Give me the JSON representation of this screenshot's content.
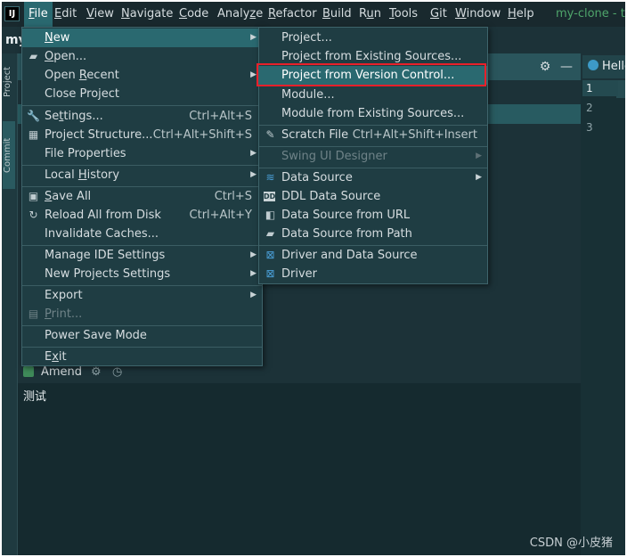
{
  "menubar": {
    "items": [
      {
        "pre": "",
        "u": "F",
        "post": "ile"
      },
      {
        "pre": "",
        "u": "E",
        "post": "dit"
      },
      {
        "pre": "",
        "u": "V",
        "post": "iew"
      },
      {
        "pre": "",
        "u": "N",
        "post": "avigate"
      },
      {
        "pre": "",
        "u": "C",
        "post": "ode"
      },
      {
        "pre": "Analy",
        "u": "z",
        "post": "e"
      },
      {
        "pre": "",
        "u": "R",
        "post": "efactor"
      },
      {
        "pre": "",
        "u": "B",
        "post": "uild"
      },
      {
        "pre": "R",
        "u": "u",
        "post": "n"
      },
      {
        "pre": "",
        "u": "T",
        "post": "ools"
      },
      {
        "pre": "",
        "u": "G",
        "post": "it"
      },
      {
        "pre": "",
        "u": "W",
        "post": "indow"
      },
      {
        "pre": "",
        "u": "H",
        "post": "elp"
      }
    ],
    "window_title": "my-clone - tes",
    "logo_text": "IJ"
  },
  "ide": {
    "project_head": "my",
    "project_tab": "Project",
    "commit_tab": "Commit",
    "editor_tab": "Hello",
    "line_numbers": [
      "1",
      "2",
      "3"
    ],
    "amend_label": "Amend",
    "commit_message": "测试",
    "watermark": "CSDN @小皮猪"
  },
  "file_menu": {
    "items": [
      {
        "pre": "",
        "u": "N",
        "post": "ew",
        "shortcut": "",
        "submenu": true,
        "icon": "",
        "selected": true
      },
      {
        "pre": "",
        "u": "O",
        "post": "pen...",
        "shortcut": "",
        "icon": "folder-icon"
      },
      {
        "pre": "Open ",
        "u": "R",
        "post": "ecent",
        "shortcut": "",
        "submenu": true
      },
      {
        "pre": "Close Project",
        "u": "",
        "post": "",
        "shortcut": ""
      },
      {
        "pre": "Se",
        "u": "t",
        "post": "tings...",
        "shortcut": "Ctrl+Alt+S",
        "icon": "wrench-icon"
      },
      {
        "pre": "Project Structure...",
        "u": "",
        "post": "",
        "shortcut": "Ctrl+Alt+Shift+S",
        "icon": "project-structure-icon"
      },
      {
        "pre": "File Properties",
        "u": "",
        "post": "",
        "shortcut": "",
        "submenu": true
      },
      {
        "pre": "Local ",
        "u": "H",
        "post": "istory",
        "shortcut": "",
        "submenu": true
      },
      {
        "pre": "",
        "u": "S",
        "post": "ave All",
        "shortcut": "Ctrl+S",
        "icon": "save-icon"
      },
      {
        "pre": "Reload All from Disk",
        "u": "",
        "post": "",
        "shortcut": "Ctrl+Alt+Y",
        "icon": "reload-icon"
      },
      {
        "pre": "Invalidate Caches...",
        "u": "",
        "post": "",
        "shortcut": ""
      },
      {
        "pre": "Manage IDE Settings",
        "u": "",
        "post": "",
        "shortcut": "",
        "submenu": true
      },
      {
        "pre": "New Projects Settings",
        "u": "",
        "post": "",
        "shortcut": "",
        "submenu": true
      },
      {
        "pre": "Export",
        "u": "",
        "post": "",
        "shortcut": "",
        "submenu": true
      },
      {
        "pre": "",
        "u": "P",
        "post": "rint...",
        "shortcut": "",
        "icon": "print-icon",
        "disabled": true
      },
      {
        "pre": "Power Save Mode",
        "u": "",
        "post": "",
        "shortcut": ""
      },
      {
        "pre": "E",
        "u": "x",
        "post": "it",
        "shortcut": ""
      }
    ]
  },
  "new_menu": {
    "items": [
      {
        "label": "Project...",
        "shortcut": ""
      },
      {
        "label": "Project from Existing Sources...",
        "shortcut": ""
      },
      {
        "label": "Project from Version Control...",
        "shortcut": "",
        "selected": true
      },
      {
        "label": "Module...",
        "shortcut": ""
      },
      {
        "label": "Module from Existing Sources...",
        "shortcut": ""
      },
      {
        "label": "Scratch File",
        "shortcut": "Ctrl+Alt+Shift+Insert",
        "icon": "scratch-file-icon"
      },
      {
        "label": "Swing UI Designer",
        "shortcut": "",
        "submenu": true,
        "disabled": true
      },
      {
        "label": "Data Source",
        "shortcut": "",
        "submenu": true,
        "icon": "database-icon"
      },
      {
        "label": "DDL Data Source",
        "shortcut": "",
        "icon": "ddl-icon"
      },
      {
        "label": "Data Source from URL",
        "shortcut": "",
        "icon": "url-source-icon"
      },
      {
        "label": "Data Source from Path",
        "shortcut": "",
        "icon": "folder-icon"
      },
      {
        "label": "Driver and Data Source",
        "shortcut": "",
        "icon": "driver-icon"
      },
      {
        "label": "Driver",
        "shortcut": "",
        "icon": "driver-icon"
      }
    ]
  },
  "colors": {
    "highlight_box": "#e8202a",
    "menu_selection": "#2a6970",
    "menu_background": "#1f3d43"
  }
}
